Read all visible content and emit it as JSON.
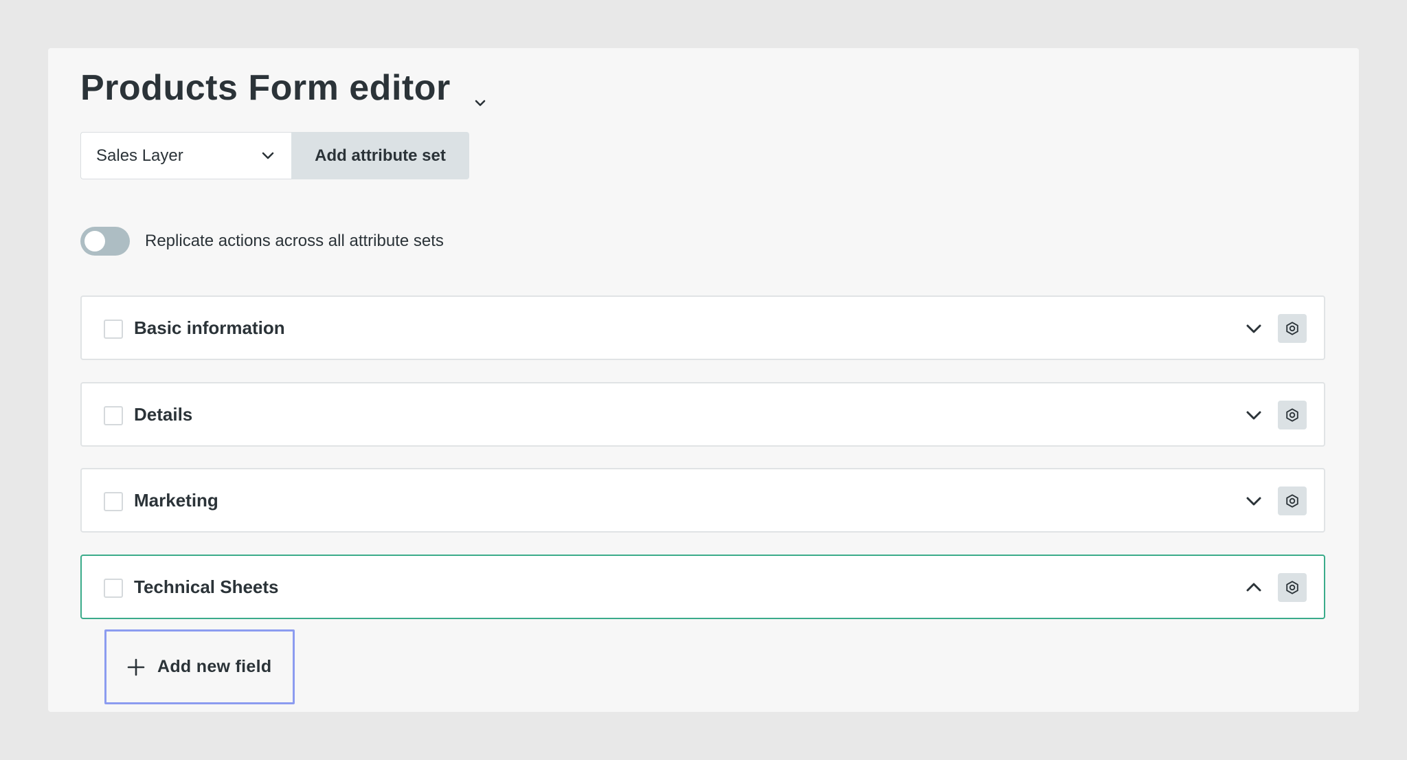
{
  "header": {
    "title": "Products Form editor"
  },
  "controls": {
    "select_value": "Sales Layer",
    "add_set_label": "Add attribute set"
  },
  "toggle": {
    "label": "Replicate actions across all attribute sets",
    "on": false
  },
  "sections": [
    {
      "title": "Basic information",
      "expanded": false,
      "checked": false
    },
    {
      "title": "Details",
      "expanded": false,
      "checked": false
    },
    {
      "title": "Marketing",
      "expanded": false,
      "checked": false
    },
    {
      "title": "Technical Sheets",
      "expanded": true,
      "checked": false
    }
  ],
  "add_field": {
    "label": "Add new field"
  },
  "colors": {
    "background": "#e8e8e8",
    "card": "#f7f7f7",
    "active_border": "#3aab8a",
    "focus_outline": "#8c9cf0",
    "toggle_off": "#adbdc3",
    "button_gray": "#dbe1e4"
  },
  "icons": {
    "title_dropdown": "chevron-down-icon",
    "select_dropdown": "chevron-down-icon",
    "section_collapsed": "chevron-down-icon",
    "section_expanded": "chevron-up-icon",
    "section_settings": "gear-icon",
    "add_field": "plus-icon"
  }
}
